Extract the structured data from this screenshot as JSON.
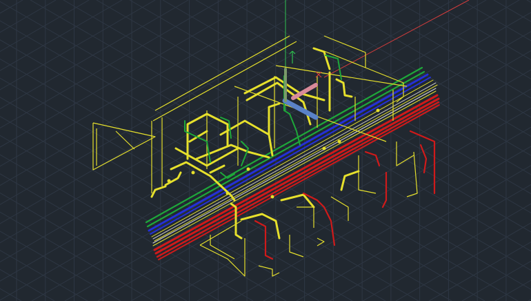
{
  "viewport": {
    "background": "#212830",
    "grid_color": "#2e3744",
    "accent_grid_color": "#323c4a"
  },
  "axes": {
    "x_color": "#d23c3c",
    "y_color": "#2fbf4f",
    "z_color": "#3c6ee0"
  },
  "layers": [
    {
      "name": "pipe-yellow",
      "color": "#e6e02c"
    },
    {
      "name": "pipe-green",
      "color": "#1ea83a"
    },
    {
      "name": "pipe-blue",
      "color": "#2430d8"
    },
    {
      "name": "pipe-red",
      "color": "#d01a1a"
    },
    {
      "name": "pipe-white",
      "color": "#d8d8d8"
    },
    {
      "name": "selected-steel",
      "color": "#5a82c8"
    },
    {
      "name": "selected-pink",
      "color": "#d88a9a"
    }
  ],
  "icons": {
    "ucs": "ucs-icon",
    "crosshair": "crosshair-icon"
  }
}
